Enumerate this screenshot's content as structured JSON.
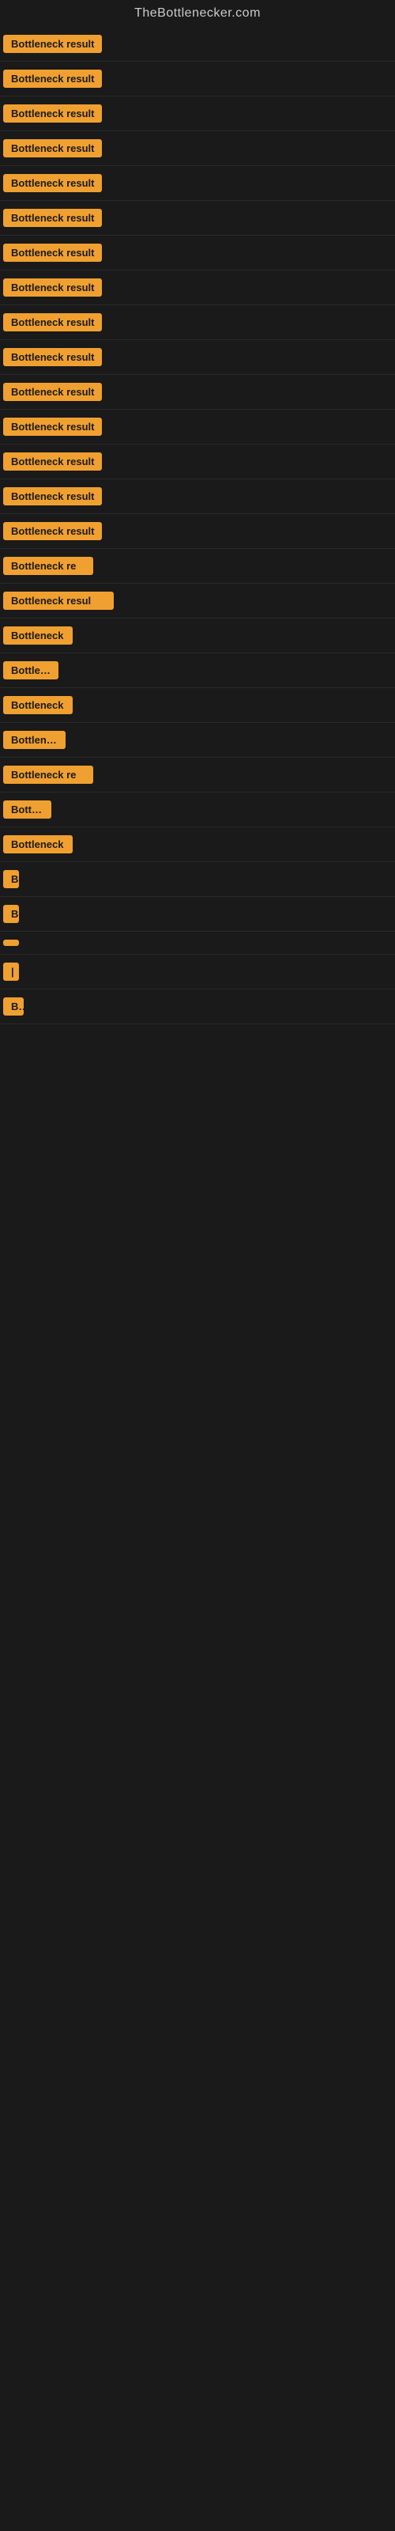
{
  "header": {
    "title": "TheBottlenecker.com"
  },
  "results": [
    {
      "id": 1,
      "label": "Bottleneck result",
      "truncated": false
    },
    {
      "id": 2,
      "label": "Bottleneck result",
      "truncated": false
    },
    {
      "id": 3,
      "label": "Bottleneck result",
      "truncated": false
    },
    {
      "id": 4,
      "label": "Bottleneck result",
      "truncated": false
    },
    {
      "id": 5,
      "label": "Bottleneck result",
      "truncated": false
    },
    {
      "id": 6,
      "label": "Bottleneck result",
      "truncated": false
    },
    {
      "id": 7,
      "label": "Bottleneck result",
      "truncated": false
    },
    {
      "id": 8,
      "label": "Bottleneck result",
      "truncated": false
    },
    {
      "id": 9,
      "label": "Bottleneck result",
      "truncated": false
    },
    {
      "id": 10,
      "label": "Bottleneck result",
      "truncated": false
    },
    {
      "id": 11,
      "label": "Bottleneck result",
      "truncated": false
    },
    {
      "id": 12,
      "label": "Bottleneck result",
      "truncated": false
    },
    {
      "id": 13,
      "label": "Bottleneck result",
      "truncated": false
    },
    {
      "id": 14,
      "label": "Bottleneck result",
      "truncated": false
    },
    {
      "id": 15,
      "label": "Bottleneck result",
      "truncated": false
    },
    {
      "id": 16,
      "label": "Bottleneck re",
      "truncated": true
    },
    {
      "id": 17,
      "label": "Bottleneck resul",
      "truncated": true
    },
    {
      "id": 18,
      "label": "Bottleneck",
      "truncated": true
    },
    {
      "id": 19,
      "label": "Bottlene",
      "truncated": true
    },
    {
      "id": 20,
      "label": "Bottleneck",
      "truncated": true
    },
    {
      "id": 21,
      "label": "Bottlenec",
      "truncated": true
    },
    {
      "id": 22,
      "label": "Bottleneck re",
      "truncated": true
    },
    {
      "id": 23,
      "label": "Bottlen",
      "truncated": true
    },
    {
      "id": 24,
      "label": "Bottleneck",
      "truncated": true
    },
    {
      "id": 25,
      "label": "Bo",
      "truncated": true
    },
    {
      "id": 26,
      "label": "B",
      "truncated": true
    },
    {
      "id": 27,
      "label": "",
      "truncated": true
    },
    {
      "id": 28,
      "label": "|",
      "truncated": true
    },
    {
      "id": 29,
      "label": "Bot",
      "truncated": true
    }
  ]
}
